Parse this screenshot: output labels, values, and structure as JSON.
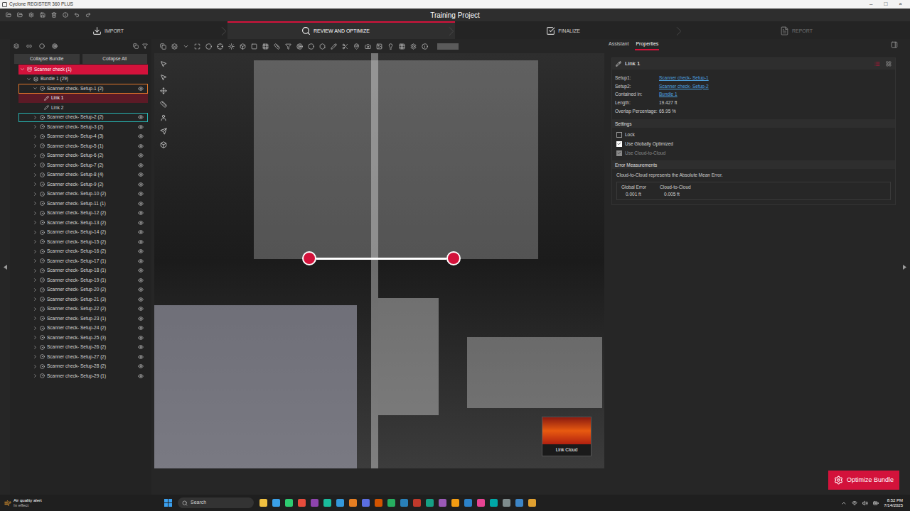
{
  "window": {
    "title": "Cyclone REGISTER 360 PLUS",
    "controls": [
      "–",
      "□",
      "×"
    ]
  },
  "project": {
    "title": "Training Project"
  },
  "workflow": [
    {
      "label": "IMPORT",
      "selected": false,
      "disabled": false
    },
    {
      "label": "REVIEW AND OPTIMIZE",
      "selected": true,
      "disabled": false
    },
    {
      "label": "FINALIZE",
      "selected": false,
      "disabled": false
    },
    {
      "label": "REPORT",
      "selected": false,
      "disabled": true
    }
  ],
  "tree": {
    "buttons": [
      "Collapse Bundle",
      "Collapse All"
    ],
    "items": [
      {
        "label": "Scanner check (1)",
        "kind": "project",
        "expanded": true,
        "selected": false
      },
      {
        "label": "Bundle 1 (29)",
        "kind": "bundle",
        "expanded": true,
        "selected": false
      },
      {
        "label": "Scanner check- Setup-1 (2)",
        "kind": "setup",
        "expanded": true,
        "selected": false,
        "color": "#e0762a"
      },
      {
        "label": "Link 1",
        "kind": "link",
        "selected": true
      },
      {
        "label": "Link 2",
        "kind": "link",
        "selected": false
      },
      {
        "label": "Scanner check- Setup-2 (2)",
        "kind": "setup",
        "expanded": false,
        "selected": false,
        "color": "#27b3b0"
      },
      {
        "label": "Scanner check- Setup-3 (2)",
        "kind": "setup",
        "expanded": false,
        "selected": false
      },
      {
        "label": "Scanner check- Setup-4 (3)",
        "kind": "setup",
        "expanded": false,
        "selected": false
      },
      {
        "label": "Scanner check- Setup-5 (1)",
        "kind": "setup",
        "expanded": false,
        "selected": false
      },
      {
        "label": "Scanner check- Setup-6 (2)",
        "kind": "setup",
        "expanded": false,
        "selected": false
      },
      {
        "label": "Scanner check- Setup-7 (2)",
        "kind": "setup",
        "expanded": false,
        "selected": false
      },
      {
        "label": "Scanner check- Setup-8 (4)",
        "kind": "setup",
        "expanded": false,
        "selected": false
      },
      {
        "label": "Scanner check- Setup-9 (2)",
        "kind": "setup",
        "expanded": false,
        "selected": false
      },
      {
        "label": "Scanner check- Setup-10 (2)",
        "kind": "setup",
        "expanded": false,
        "selected": false
      },
      {
        "label": "Scanner check- Setup-11 (1)",
        "kind": "setup",
        "expanded": false,
        "selected": false
      },
      {
        "label": "Scanner check- Setup-12 (2)",
        "kind": "setup",
        "expanded": false,
        "selected": false
      },
      {
        "label": "Scanner check- Setup-13 (2)",
        "kind": "setup",
        "expanded": false,
        "selected": false
      },
      {
        "label": "Scanner check- Setup-14 (2)",
        "kind": "setup",
        "expanded": false,
        "selected": false
      },
      {
        "label": "Scanner check- Setup-15 (2)",
        "kind": "setup",
        "expanded": false,
        "selected": false
      },
      {
        "label": "Scanner check- Setup-16 (2)",
        "kind": "setup",
        "expanded": false,
        "selected": false
      },
      {
        "label": "Scanner check- Setup-17 (1)",
        "kind": "setup",
        "expanded": false,
        "selected": false
      },
      {
        "label": "Scanner check- Setup-18 (1)",
        "kind": "setup",
        "expanded": false,
        "selected": false
      },
      {
        "label": "Scanner check- Setup-19 (1)",
        "kind": "setup",
        "expanded": false,
        "selected": false
      },
      {
        "label": "Scanner check- Setup-20 (2)",
        "kind": "setup",
        "expanded": false,
        "selected": false
      },
      {
        "label": "Scanner check- Setup-21 (3)",
        "kind": "setup",
        "expanded": false,
        "selected": false
      },
      {
        "label": "Scanner check- Setup-22 (2)",
        "kind": "setup",
        "expanded": false,
        "selected": false
      },
      {
        "label": "Scanner check- Setup-23 (1)",
        "kind": "setup",
        "expanded": false,
        "selected": false
      },
      {
        "label": "Scanner check- Setup-24 (2)",
        "kind": "setup",
        "expanded": false,
        "selected": false
      },
      {
        "label": "Scanner check- Setup-25 (3)",
        "kind": "setup",
        "expanded": false,
        "selected": false
      },
      {
        "label": "Scanner check- Setup-26 (2)",
        "kind": "setup",
        "expanded": false,
        "selected": false
      },
      {
        "label": "Scanner check- Setup-27 (2)",
        "kind": "setup",
        "expanded": false,
        "selected": false
      },
      {
        "label": "Scanner check- Setup-28 (2)",
        "kind": "setup",
        "expanded": false,
        "selected": false
      },
      {
        "label": "Scanner check- Setup-29 (1)",
        "kind": "setup",
        "expanded": false,
        "selected": false
      }
    ]
  },
  "viewport": {
    "thumbnail": {
      "label": "Link Cloud"
    }
  },
  "panel": {
    "tabs": [
      {
        "label": "Assistant",
        "selected": false
      },
      {
        "label": "Properties",
        "selected": true
      }
    ],
    "title": "Link 1",
    "properties": [
      {
        "label": "Setup1:",
        "value": "Scanner check- Setup-1",
        "kind": "link"
      },
      {
        "label": "Setup2:",
        "value": "Scanner check- Setup-2",
        "kind": "link"
      },
      {
        "label": "Contained in:",
        "value": "Bundle 1",
        "kind": "link"
      },
      {
        "label": "Length:",
        "value": "19.427 ft",
        "kind": "text"
      },
      {
        "label": "Overlap Percentage:",
        "value": "65.95 %",
        "kind": "text"
      }
    ],
    "settings_title": "Settings",
    "settings": [
      {
        "label": "Lock",
        "checked": false,
        "disabled": false
      },
      {
        "label": "Use Globally Optimized",
        "checked": true,
        "disabled": false
      },
      {
        "label": "Use Cloud-to-Cloud",
        "checked": true,
        "disabled": true
      }
    ],
    "errors_title": "Error Measurements",
    "errors_note": "Cloud-to-Cloud represents the Absolute Mean Error.",
    "errors_columns": [
      "Global Error",
      "Cloud-to-Cloud"
    ],
    "errors_values": [
      "0.001 ft",
      "0.005 ft"
    ]
  },
  "optimize_button": "Optimize Bundle",
  "taskbar": {
    "weather_title": "Air quality alert",
    "weather_sub": "In effect",
    "search": "Search",
    "time": "8:52 PM",
    "date": "7/14/2025"
  }
}
